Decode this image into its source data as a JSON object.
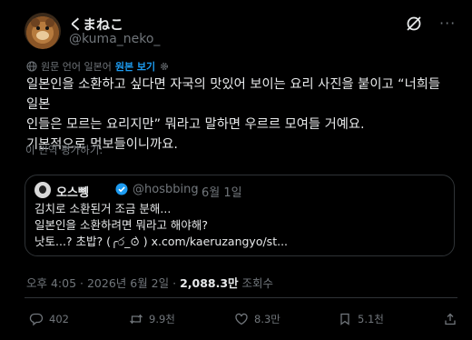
{
  "author": {
    "display_name": "くまねこ",
    "handle": "@kuma_neko_",
    "avatar_icon": "bear-avatar"
  },
  "header_icons": {
    "grok": "grok-icon",
    "more": "more-icon"
  },
  "translation": {
    "source_note": "원문 언어 일본어",
    "show_original": "원본 보기",
    "rate": "이 번역 평가하기:"
  },
  "tweet_lines": [
    "일본인을 소환하고 싶다면 자국의 맛있어 보이는 요리 사진을 붙이고 “너희들 일본",
    "인들은 모르는 요리지만” 뭐라고 말하면 우르르 모여들 거예요.",
    "기본적으로 먹보들이니까요."
  ],
  "quote": {
    "display_name": "오스뼹",
    "handle": "@hosbbing",
    "separator": "·",
    "date": "6월 1일",
    "lines": [
      "김치로 소환된거 조금 분해...",
      "일본인을 소환하려면 뭐라고 해야해?",
      "낫토...? 초밥? (╭ර_⊙̀ ) x.com/kaeruzangyo/st..."
    ]
  },
  "meta": {
    "time": "오후 4:05",
    "separator": " · ",
    "date": "2026년 6월 2일",
    "views_count": "2,088.3만",
    "views_label": "조회수"
  },
  "actions": {
    "reply": "402",
    "retweet": "9.9천",
    "like": "8.3만",
    "bookmark": "5.1천"
  },
  "colors": {
    "background": "#000000",
    "text": "#e7e9ea",
    "muted": "#71767b",
    "accent": "#1d9bf0",
    "border": "#2f3336"
  }
}
